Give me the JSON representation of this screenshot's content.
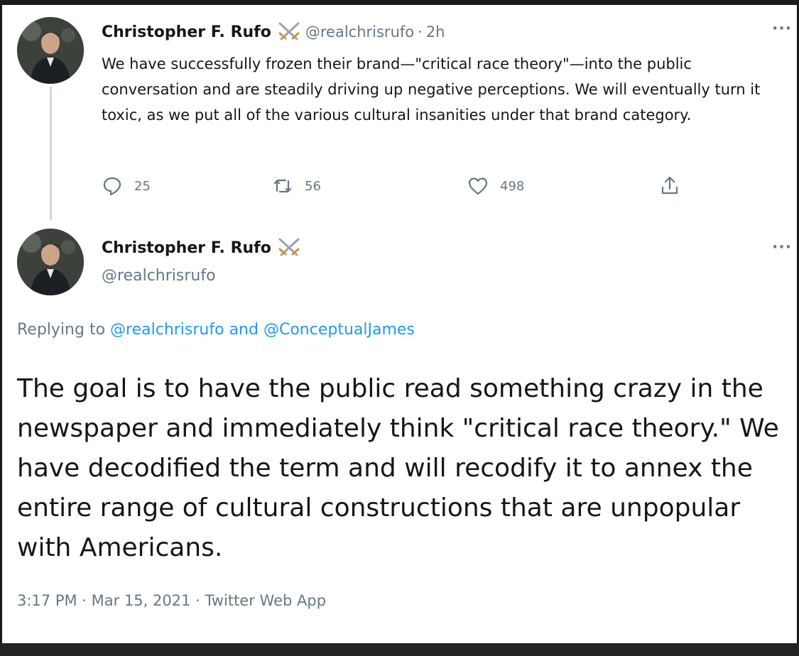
{
  "tweet1": {
    "author_name": "Christopher F. Rufo",
    "handle": "@realchrisrufo",
    "separator": "·",
    "time": "2h",
    "more": "···",
    "text": "We have successfully frozen their brand—\"critical race theory\"—into the public conversation and are steadily driving up negative perceptions. We will eventually turn it toxic, as we put all of the various cultural insanities under that brand category.",
    "stats": {
      "replies": "25",
      "retweets": "56",
      "likes": "498"
    },
    "icons": [
      "reply-icon",
      "retweet-icon",
      "like-icon",
      "share-icon",
      "crossed-swords-icon"
    ]
  },
  "tweet2": {
    "author_name": "Christopher F. Rufo",
    "handle": "@realchrisrufo",
    "more": "···",
    "replying_prefix": "Replying to ",
    "replying_to_1": "@realchrisrufo",
    "replying_and": " and ",
    "replying_to_2": "@ConceptualJames",
    "text": "The goal is to have the public read something crazy in the newspaper and immediately think \"critical race theory.\" We have decodified the term and will recodify it to annex the entire range of cultural constructions that are unpopular with Americans.",
    "timestamp": "3:17 PM · Mar 15, 2021 · Twitter Web App"
  },
  "colors": {
    "text": "#14171a",
    "secondary": "#657786",
    "link": "#1d9bf0",
    "thread_line": "#cfd9de"
  }
}
